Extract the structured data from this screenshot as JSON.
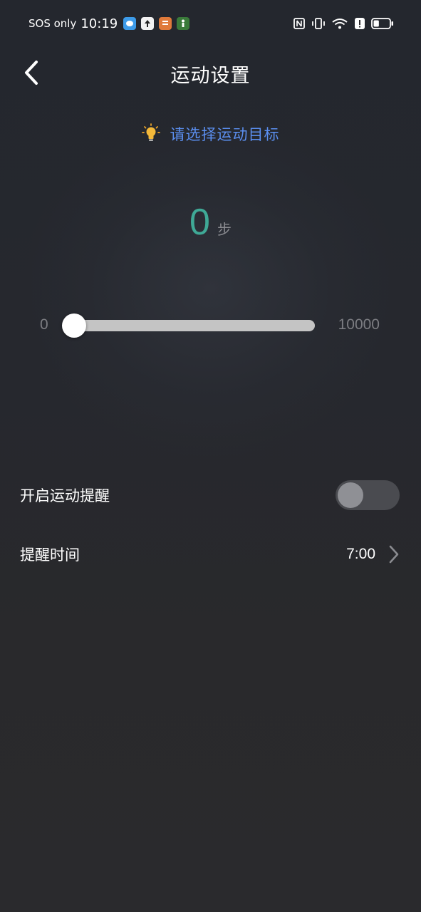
{
  "status_bar": {
    "carrier": "SOS only",
    "time": "10:19",
    "notifications": [
      {
        "icon": "chat-app-icon",
        "color": "#3d9be9"
      },
      {
        "icon": "upload-app-icon",
        "color": "#f2f2f2"
      },
      {
        "icon": "news-app-icon",
        "color": "#e07a3a"
      },
      {
        "icon": "runner-app-icon",
        "color": "#3a7a3a"
      }
    ],
    "indicators": [
      "nfc-icon",
      "vibrate-icon",
      "wifi-icon",
      "alert-icon",
      "battery-icon"
    ],
    "battery_level": 0.35
  },
  "header": {
    "back_icon": "back-arrow-icon",
    "title": "运动设置"
  },
  "hint": {
    "icon": "lightbulb-icon",
    "text": "请选择运动目标"
  },
  "goal": {
    "value": "0",
    "unit": "步"
  },
  "slider": {
    "min_label": "0",
    "max_label": "10000",
    "min": 0,
    "max": 10000,
    "value": 0
  },
  "settings": {
    "reminder": {
      "label": "开启运动提醒",
      "enabled": false
    },
    "reminder_time": {
      "label": "提醒时间",
      "value": "7:00",
      "icon": "chevron-right-icon"
    }
  },
  "colors": {
    "accent_teal": "#3fa996",
    "hint_blue": "#5b8ff0",
    "background": "#2a2a2d"
  }
}
